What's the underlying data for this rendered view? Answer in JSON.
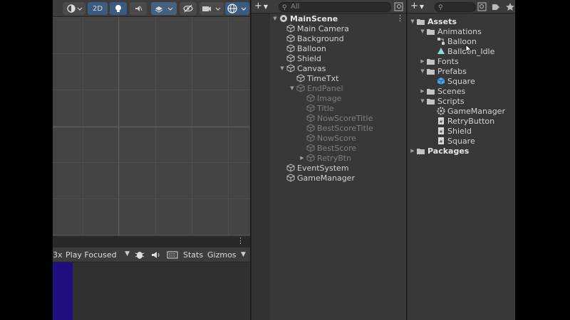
{
  "scene": {
    "toolbar": {
      "mode_2d": "2D"
    }
  },
  "game": {
    "scale_text": "3x",
    "play_mode": "Play Focused",
    "stats": "Stats",
    "gizmos": "Gizmos"
  },
  "hierarchy": {
    "search_placeholder": "All",
    "scene_name": "MainScene",
    "items": [
      {
        "label": "Main Camera"
      },
      {
        "label": "Background"
      },
      {
        "label": "Balloon"
      },
      {
        "label": "Shield"
      },
      {
        "label": "Canvas"
      },
      {
        "label": "TimeTxt"
      },
      {
        "label": "EndPanel"
      },
      {
        "label": "Image"
      },
      {
        "label": "Title"
      },
      {
        "label": "NowScoreTitle"
      },
      {
        "label": "BestScoreTitle"
      },
      {
        "label": "NowScore"
      },
      {
        "label": "BestScore"
      },
      {
        "label": "RetryBtn"
      },
      {
        "label": "EventSystem"
      },
      {
        "label": "GameManager"
      }
    ]
  },
  "project": {
    "items": [
      {
        "label": "Assets"
      },
      {
        "label": "Animations"
      },
      {
        "label": "Balloon"
      },
      {
        "label": "Balloon_Idle"
      },
      {
        "label": "Fonts"
      },
      {
        "label": "Prefabs"
      },
      {
        "label": "Square"
      },
      {
        "label": "Scenes"
      },
      {
        "label": "Scripts"
      },
      {
        "label": "GameManager"
      },
      {
        "label": "RetryButton"
      },
      {
        "label": "Shield"
      },
      {
        "label": "Square"
      },
      {
        "label": "Packages"
      }
    ]
  },
  "colors": {
    "panel_bg": "#383838",
    "toolbar_bg": "#3c3c3c",
    "accent_blue": "#3d5a80",
    "game_canvas": "#1d0f80"
  }
}
